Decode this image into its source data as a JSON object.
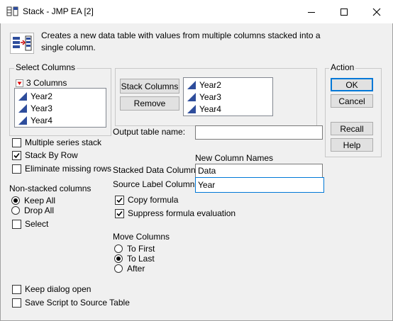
{
  "window": {
    "title": "Stack - JMP EA [2]",
    "controls": [
      "minimize",
      "maximize",
      "close"
    ]
  },
  "description": "Creates a new data table with values from multiple columns stacked into a single column.",
  "select_columns": {
    "label": "Select Columns",
    "count_label": "3 Columns",
    "items": [
      "Year2",
      "Year3",
      "Year4"
    ]
  },
  "stack_panel": {
    "stack_button": "Stack Columns",
    "remove_button": "Remove",
    "items": [
      "Year2",
      "Year3",
      "Year4"
    ]
  },
  "action": {
    "label": "Action",
    "ok": "OK",
    "cancel": "Cancel",
    "recall": "Recall",
    "help": "Help"
  },
  "options": {
    "multiple_series_stack": {
      "label": "Multiple series stack",
      "checked": false
    },
    "stack_by_row": {
      "label": "Stack By Row",
      "checked": true
    },
    "eliminate_missing_rows": {
      "label": "Eliminate missing rows",
      "checked": false
    }
  },
  "output_table": {
    "label": "Output table name:",
    "value": ""
  },
  "new_column_names": {
    "heading": "New Column Names",
    "stacked_label": "Stacked Data Column",
    "stacked_value": "Data",
    "source_label": "Source Label Column",
    "source_value": "Year"
  },
  "formula": {
    "copy_formula": {
      "label": "Copy formula",
      "checked": true
    },
    "suppress_eval": {
      "label": "Suppress formula evaluation",
      "checked": true
    }
  },
  "non_stacked": {
    "heading": "Non-stacked columns",
    "keep_all": "Keep All",
    "drop_all": "Drop All",
    "select": "Select",
    "selected": "Keep All"
  },
  "move_columns": {
    "heading": "Move Columns",
    "to_first": "To First",
    "to_last": "To Last",
    "after": "After",
    "selected": "To Last"
  },
  "footer": {
    "keep_dialog_open": {
      "label": "Keep dialog open",
      "checked": false
    },
    "save_script": {
      "label": "Save Script to Source Table",
      "checked": false
    }
  },
  "colors": {
    "accent": "#0078d7",
    "column_icon": "#2e4d9c"
  }
}
